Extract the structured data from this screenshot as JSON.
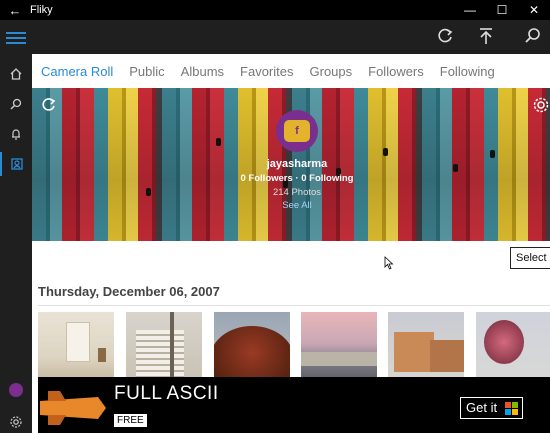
{
  "window": {
    "title": "Fliky",
    "back_icon": "back-arrow-icon"
  },
  "appbar": {
    "icons": [
      "hamburger-icon",
      "refresh-icon",
      "upload-icon",
      "search-icon"
    ]
  },
  "leftnav": {
    "items": [
      "home-icon",
      "search-icon",
      "bell-icon",
      "camera-roll-icon"
    ],
    "bottom": [
      "flickr-profile-icon",
      "gear-icon"
    ]
  },
  "tabs": [
    "Camera Roll",
    "Public",
    "Albums",
    "Favorites",
    "Groups",
    "Followers",
    "Following"
  ],
  "profile": {
    "username": "jayasharma",
    "stats": "0 Followers  ·  0 Following",
    "photos": "214 Photos",
    "see_all": "See All"
  },
  "select_label": "Select",
  "section_date": "Thursday, December 06, 2007",
  "ad": {
    "title": "FULL ASCII",
    "badge": "FREE",
    "button": "Get it",
    "logo_text": "FULL ASCII"
  },
  "colors": {
    "accent": "#2a8ad4",
    "dark": "#1f1f1f"
  }
}
